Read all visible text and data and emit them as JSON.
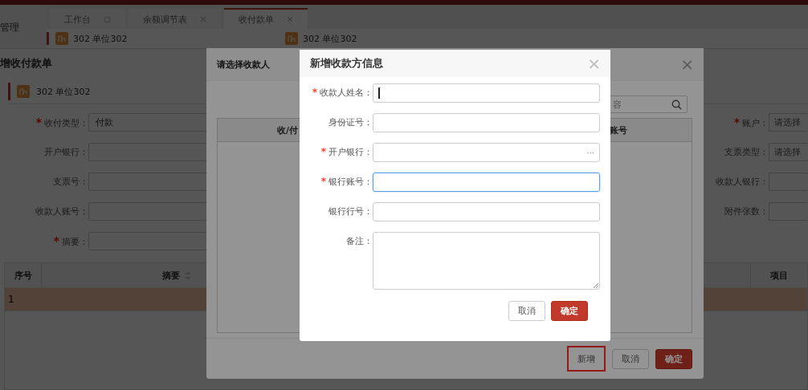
{
  "app": {
    "sidebar_items": [
      {
        "label": "管理"
      }
    ],
    "tabs": [
      {
        "label": "工作台",
        "selected": false,
        "closable": false
      },
      {
        "label": "余额调节表",
        "selected": false,
        "closable": true
      },
      {
        "label": "收付款单",
        "selected": true,
        "closable": true
      }
    ],
    "units": [
      "302 单位302",
      "302 单位302"
    ]
  },
  "form_dialog": {
    "title": "增收付款单",
    "unit": "302 单位302",
    "left_fields": [
      {
        "required_mark": "*",
        "label": "收付类型：",
        "value": "付款"
      },
      {
        "label": "开户银行："
      },
      {
        "label": "支票号："
      },
      {
        "label": "收款人账号："
      },
      {
        "required_mark": "*",
        "label": "摘要："
      }
    ],
    "right_fields": [
      {
        "required_mark": "*",
        "label": "账户：",
        "placeholder": "请选择"
      },
      {
        "label": "支票类型：",
        "placeholder": "请选择"
      },
      {
        "label": "收款人银行："
      },
      {
        "label": "附件张数："
      }
    ],
    "table": {
      "columns": [
        {
          "label": "序号",
          "sortable": false
        },
        {
          "label": "摘要",
          "sortable": true
        },
        {
          "label": "项目",
          "sortable": false
        }
      ],
      "rows": [
        {
          "index": "1",
          "selected": true
        }
      ]
    }
  },
  "payee_dialog": {
    "title": "请选择收款人",
    "close": "×",
    "search_placeholder": "容",
    "columns": [
      "收/付",
      "账号"
    ],
    "buttons": [
      {
        "label": "新增",
        "kind": "highlighted"
      },
      {
        "label": "取消",
        "kind": "default"
      },
      {
        "label": "确定",
        "kind": "primary"
      }
    ]
  },
  "new_payee_dialog": {
    "title": "新增收款方信息",
    "close": "×",
    "fields": [
      {
        "required_mark": "*",
        "label": "收款人姓名：",
        "kind": "text",
        "focused": false,
        "caret": true
      },
      {
        "label": "身份证号：",
        "kind": "text",
        "focused": false
      },
      {
        "required_mark": "*",
        "label": "开户银行：",
        "kind": "picker",
        "picker_text": "···"
      },
      {
        "required_mark": "*",
        "label": "银行账号：",
        "kind": "text",
        "focused": true
      },
      {
        "label": "银行行号：",
        "kind": "text",
        "focused": false
      },
      {
        "label": "备注：",
        "kind": "textarea"
      }
    ],
    "buttons": [
      {
        "label": "取消",
        "kind": "default"
      },
      {
        "label": "确定",
        "kind": "primary"
      }
    ]
  }
}
